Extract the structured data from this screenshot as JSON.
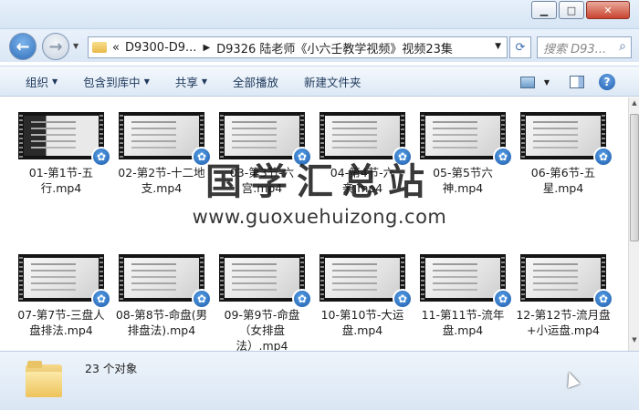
{
  "window": {
    "controls": {
      "minimize": "▁",
      "maximize": "□",
      "close": "✕"
    }
  },
  "nav": {
    "back_icon": "←",
    "forward_icon": "→",
    "dropdown_icon": "▼"
  },
  "address": {
    "prefix": "«",
    "crumbs": [
      "D9300-D9...",
      "D9326 陆老师《小六壬教学视频》视频23集"
    ],
    "separator": "▶"
  },
  "search": {
    "placeholder": "搜索 D93...",
    "icon": "search-icon"
  },
  "commands": [
    {
      "label": "组织",
      "has_menu": true
    },
    {
      "label": "包含到库中",
      "has_menu": true
    },
    {
      "label": "共享",
      "has_menu": true
    },
    {
      "label": "全部播放",
      "has_menu": false
    },
    {
      "label": "新建文件夹",
      "has_menu": false
    }
  ],
  "files": [
    {
      "name": "01-第1节-五行.mp4",
      "frame": "dark"
    },
    {
      "name": "02-第2节-十二地支.mp4",
      "frame": "light"
    },
    {
      "name": "03-第3节-六宫.mp4",
      "frame": "light"
    },
    {
      "name": "04-第4节-六亲.mp4",
      "frame": "light"
    },
    {
      "name": "05-第5节六神.mp4",
      "frame": "light"
    },
    {
      "name": "06-第6节-五星.mp4",
      "frame": "light"
    },
    {
      "name": "07-第7节-三盘人盘排法.mp4",
      "frame": "light"
    },
    {
      "name": "08-第8节-命盘(男排盘法).mp4",
      "frame": "light"
    },
    {
      "name": "09-第9节-命盘（女排盘法）.mp4",
      "frame": "light"
    },
    {
      "name": "10-第10节-大运盘.mp4",
      "frame": "light"
    },
    {
      "name": "11-第11节-流年盘.mp4",
      "frame": "light"
    },
    {
      "name": "12-第12节-流月盘+小运盘.mp4",
      "frame": "light"
    }
  ],
  "watermark": {
    "title": "国学汇总站",
    "url": "www.guoxuehuizong.com"
  },
  "details": {
    "count_text": "23 个对象"
  }
}
